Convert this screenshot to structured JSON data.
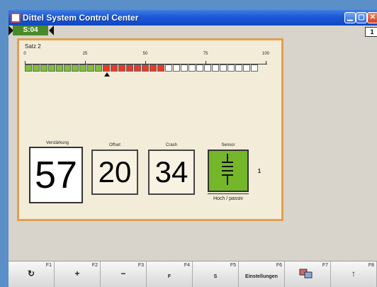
{
  "window": {
    "title": "Dittel System Control Center",
    "badge": "1"
  },
  "status": {
    "label": "S:04"
  },
  "panel": {
    "title": "Satz 2",
    "scale": [
      "0",
      "25",
      "50",
      "75",
      "100"
    ],
    "bar": {
      "segments_total": 30,
      "green_count": 10,
      "red_count": 8,
      "marker_value": 34
    },
    "readouts": {
      "verstaerkung": {
        "label": "Verstärkung",
        "value": "57"
      },
      "offset": {
        "label": "Offset",
        "value": "20"
      },
      "crash": {
        "label": "Crash",
        "value": "34"
      },
      "sensor": {
        "label": "Sensor",
        "side_label": "1",
        "caption": "Hoch / passiv"
      }
    }
  },
  "function_bar": {
    "keys": [
      {
        "fn": "F1",
        "symbol": "↻",
        "text": ""
      },
      {
        "fn": "F2",
        "symbol": "+",
        "text": ""
      },
      {
        "fn": "F3",
        "symbol": "−",
        "text": ""
      },
      {
        "fn": "F4",
        "symbol": "",
        "text": "F"
      },
      {
        "fn": "F5",
        "symbol": "",
        "text": "S"
      },
      {
        "fn": "F6",
        "symbol": "",
        "text": "Einstellungen"
      },
      {
        "fn": "F7",
        "symbol": "",
        "text": ""
      },
      {
        "fn": "F8",
        "symbol": "↑",
        "text": ""
      }
    ]
  },
  "colors": {
    "title_bar": "#1f5ad8",
    "panel_border": "#e0a050",
    "green": "#7fbf3a",
    "red": "#e43b2a",
    "sensor_green": "#74b82a"
  }
}
